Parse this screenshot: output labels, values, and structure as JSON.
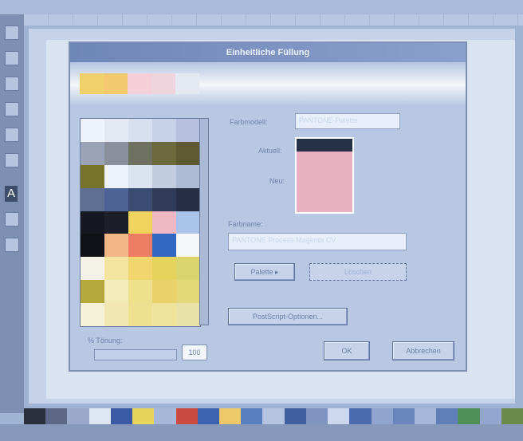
{
  "dialog": {
    "title": "Einheitliche Füllung",
    "color_model_label": "Farbmodell:",
    "color_model_value": "PANTONE-Palette",
    "old_label": "Aktuell:",
    "new_label": "Neu:",
    "color_name_label": "Farbname:",
    "color_name_value": "PANTONE Process Magenta CV",
    "palette_button": "Palette",
    "palette_arrow": "▸",
    "disabled_button": "Löschen",
    "options_button": "PostScript-Optionen...",
    "tint_label": "% Tönung:",
    "tint_value": "100",
    "ok_button": "OK",
    "cancel_button": "Abbrechen"
  },
  "colors": {
    "preview_new": "#e9b0c0",
    "preview_old": "#263047"
  }
}
